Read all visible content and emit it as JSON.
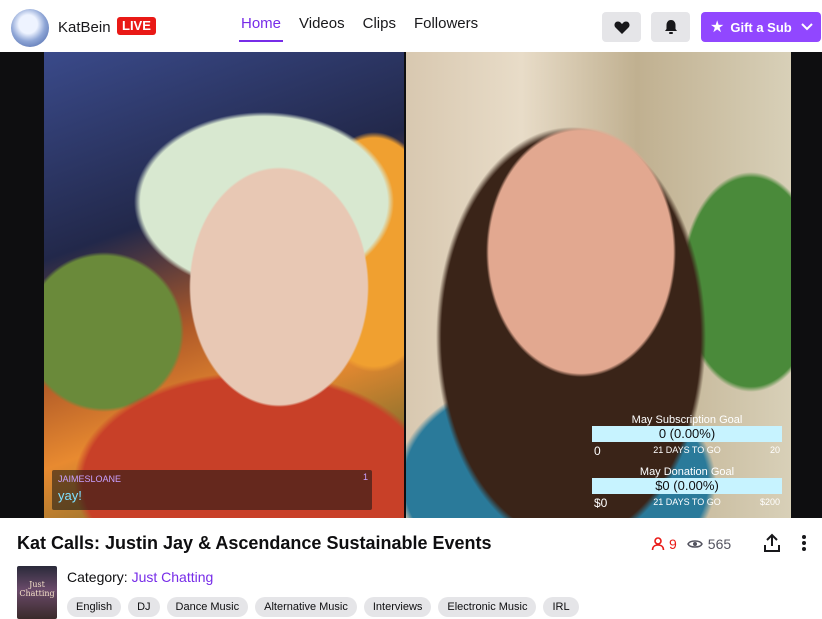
{
  "header": {
    "channel_name": "KatBein",
    "live_label": "LIVE",
    "nav": [
      "Home",
      "Videos",
      "Clips",
      "Followers"
    ],
    "active_nav": "Home",
    "gift_label": "Gift a Sub"
  },
  "video": {
    "chat": {
      "username": "JAIMESLOANE",
      "message": "yay!",
      "badge": "1"
    },
    "goals": [
      {
        "title": "May Subscription Goal",
        "value": "0 (0.00%)",
        "min": "0",
        "days": "21 DAYS TO GO",
        "max": "20"
      },
      {
        "title": "May Donation Goal",
        "value": "$0 (0.00%)",
        "min": "$0",
        "days": "21 DAYS TO GO",
        "max": "$200"
      }
    ]
  },
  "info": {
    "title": "Kat Calls: Justin Jay & Ascendance Sustainable Events",
    "viewer_count": "9",
    "view_count": "565",
    "category_label": "Category:",
    "category": "Just Chatting",
    "thumb_text": "Just Chatting",
    "tags": [
      "English",
      "DJ",
      "Dance Music",
      "Alternative Music",
      "Interviews",
      "Electronic Music",
      "IRL"
    ]
  },
  "colors": {
    "accent": "#772ce8",
    "gift_button": "#9147ff",
    "live": "#e91916"
  }
}
